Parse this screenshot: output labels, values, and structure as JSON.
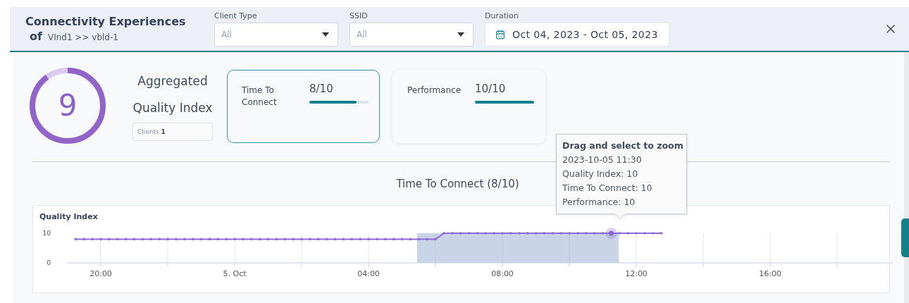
{
  "header": {
    "title": "Connectivity Experiences",
    "of_label": "of",
    "path": "VInd1 >> vbld-1",
    "filters": [
      {
        "kind": "select",
        "label": "Client Type",
        "value": "All"
      },
      {
        "kind": "select",
        "label": "SSID",
        "value": "All"
      },
      {
        "kind": "date",
        "label": "Duration",
        "value": "Oct 04, 2023 - Oct 05, 2023"
      }
    ]
  },
  "summary": {
    "score": "9",
    "label": "Aggregated Quality Index",
    "clients": "Clients **1**"
  },
  "metrics": [
    {
      "label": "Time To Connect",
      "value": "8/10",
      "level": 0.8,
      "selected": true
    },
    {
      "label": "Performance",
      "value": "10/10",
      "level": 1,
      "selected": false
    }
  ],
  "detail_title": "Time To Connect (8/10)",
  "chart": {
    "chart_data": {
      "type": "line",
      "ylim": [
        0,
        10
      ],
      "yticks": [
        0,
        10
      ],
      "categories": [
        null,
        null,
        null,
        "20:00",
        null,
        null,
        null,
        null,
        null,
        null,
        null,
        null,
        null,
        null,
        null,
        null,
        null,
        null,
        null,
        "5. Oct",
        null,
        null,
        null,
        null,
        null,
        null,
        null,
        null,
        null,
        null,
        null,
        null,
        null,
        null,
        null,
        "04:00",
        null,
        null,
        null,
        null,
        null,
        null,
        null,
        null,
        null,
        null,
        null,
        null,
        null,
        null,
        null,
        "08:00",
        null,
        null,
        null,
        null,
        null,
        null,
        null,
        null,
        null,
        null,
        null,
        null,
        null,
        null,
        null,
        "12:00",
        null,
        null,
        null,
        null,
        null,
        null,
        null,
        null,
        null,
        null,
        null,
        null,
        null,
        null,
        null,
        "16:00",
        null,
        null,
        null,
        null,
        null,
        null,
        null,
        null,
        null,
        null,
        null,
        null,
        null,
        null
      ],
      "series": [
        {
          "name": "Quality Index",
          "color": "#8e6ad8",
          "values": [
            8,
            8,
            8,
            8,
            8,
            8,
            8,
            8,
            8,
            8,
            8,
            8,
            8,
            8,
            8,
            8,
            8,
            8,
            8,
            8,
            8,
            8,
            8,
            8,
            8,
            8,
            8,
            8,
            8,
            8,
            8,
            8,
            8,
            8,
            8,
            8,
            8,
            8,
            8,
            8,
            8,
            8,
            8,
            8,
            10,
            10,
            10,
            10,
            10,
            10,
            10,
            10,
            10,
            10,
            10,
            10,
            10,
            10,
            10,
            10,
            10,
            10,
            10,
            10,
            10,
            10,
            10,
            10,
            10,
            10,
            10,
            null,
            null,
            null,
            null,
            null,
            null,
            null,
            null,
            null,
            null,
            null,
            null,
            null,
            null,
            null,
            null,
            null,
            null,
            null,
            null,
            null,
            null,
            null,
            null,
            null,
            null,
            null
          ]
        }
      ],
      "grid": true
    },
    "tooltip": {
      "title": "Drag and select to zoom",
      "lines": [
        "2023-10-05 11:30",
        "Quality Index: 10",
        "Time To Connect: 10",
        "Performance: 10"
      ]
    }
  }
}
